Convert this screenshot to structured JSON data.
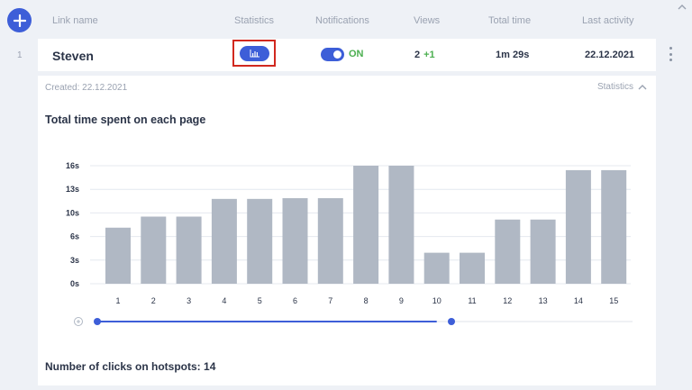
{
  "header": {
    "link_name": "Link name",
    "statistics": "Statistics",
    "notifications": "Notifications",
    "views": "Views",
    "total_time": "Total time",
    "last_activity": "Last activity"
  },
  "row": {
    "index": "1",
    "name": "Steven",
    "notifications_state": "ON",
    "views": "2",
    "views_delta": "+1",
    "total_time": "1m 29s",
    "last_activity": "22.12.2021"
  },
  "panel": {
    "created": "Created: 22.12.2021",
    "statistics_toggle": "Statistics",
    "chart_title": "Total time spent on each page",
    "clicks_label": "Number of clicks on hotspots:",
    "clicks_value": "14"
  },
  "colors": {
    "accent": "#3d5ed8",
    "on_green": "#4caf50",
    "bar": "#b0b8c4",
    "highlight_frame": "#d1281f"
  },
  "icons": {
    "add": "plus-icon",
    "statistics": "bar-chart-icon",
    "more": "more-vertical-icon",
    "collapse": "chevron-up-icon",
    "zoom": "zoom-in-icon"
  },
  "chart_data": {
    "type": "bar",
    "title": "Total time spent on each page",
    "categories": [
      "1",
      "2",
      "3",
      "4",
      "5",
      "6",
      "7",
      "8",
      "9",
      "10",
      "11",
      "12",
      "13",
      "14",
      "15"
    ],
    "values": [
      7.6,
      9.1,
      9.1,
      11.5,
      11.5,
      11.6,
      11.6,
      16,
      16,
      4.2,
      4.2,
      8.7,
      8.7,
      15.4,
      15.4
    ],
    "yticks": [
      "0s",
      "3s",
      "6s",
      "10s",
      "13s",
      "16s"
    ],
    "ylim": [
      0,
      16
    ],
    "grid": true,
    "range_slider": {
      "start_page": 1,
      "end_page": 10
    }
  }
}
